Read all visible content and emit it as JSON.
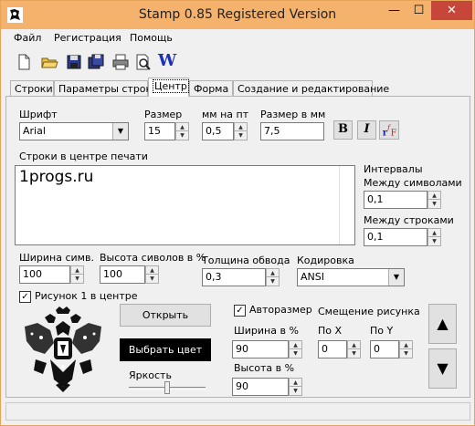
{
  "window": {
    "title": "Stamp 0.85 Registered Version",
    "accent_color": "#f4b26c",
    "close_color": "#c7463a",
    "minimize_glyph": "—",
    "maximize_glyph": "☐",
    "close_glyph": "✕"
  },
  "menu": [
    "Файл",
    "Регистрация",
    "Помощь"
  ],
  "toolbar": {
    "icons": [
      "new-file-icon",
      "open-folder-icon",
      "save-icon",
      "save-as-icon",
      "print-icon",
      "print-preview-icon",
      "word-icon"
    ],
    "word_label": "W"
  },
  "tabs": [
    "Строки",
    "Параметры строк",
    "Центр",
    "Форма",
    "Создание и редактирование"
  ],
  "active_tab": "Центр",
  "font": {
    "label": "Шрифт",
    "value": "Arial"
  },
  "size": {
    "label": "Размер",
    "value": "15"
  },
  "mm_per_pt": {
    "label": "мм на пт",
    "value": "0,5"
  },
  "size_mm": {
    "label": "Размер в мм",
    "value": "7,5"
  },
  "style_buttons": {
    "bold": "B",
    "italic": "I"
  },
  "center_lines": {
    "label": "Строки в центре печати",
    "text": "1progs.ru"
  },
  "intervals": {
    "label": "Интервалы",
    "char_spacing_label": "Между символами",
    "char_spacing_value": "0,1",
    "line_spacing_label": "Между строками",
    "line_spacing_value": "0,1"
  },
  "char_width": {
    "label": "Ширина симв.",
    "value": "100"
  },
  "char_height": {
    "label": "Высота сиволов в %",
    "value": "100"
  },
  "stroke_width": {
    "label": "Толщина обвода",
    "value": "0,3"
  },
  "encoding": {
    "label": "Кодировка",
    "value": "ANSI"
  },
  "picture": {
    "checkbox_label": "Рисунок 1 в центре",
    "checked": true
  },
  "open_button": "Открыть",
  "color_button": "Выбрать цвет",
  "brightness": {
    "label": "Яркость",
    "level": 0.5
  },
  "autosize": {
    "label": "Авторазмер",
    "checked": true
  },
  "picture_offset": {
    "label": "Смещение рисунка",
    "x_label": "По X",
    "x_value": "0",
    "y_label": "По Y",
    "y_value": "0"
  },
  "pic_width": {
    "label": "Ширина в %",
    "value": "90"
  },
  "pic_height": {
    "label": "Высота в %",
    "value": "90"
  },
  "nav": {
    "up_glyph": "▲",
    "down_glyph": "▼"
  }
}
